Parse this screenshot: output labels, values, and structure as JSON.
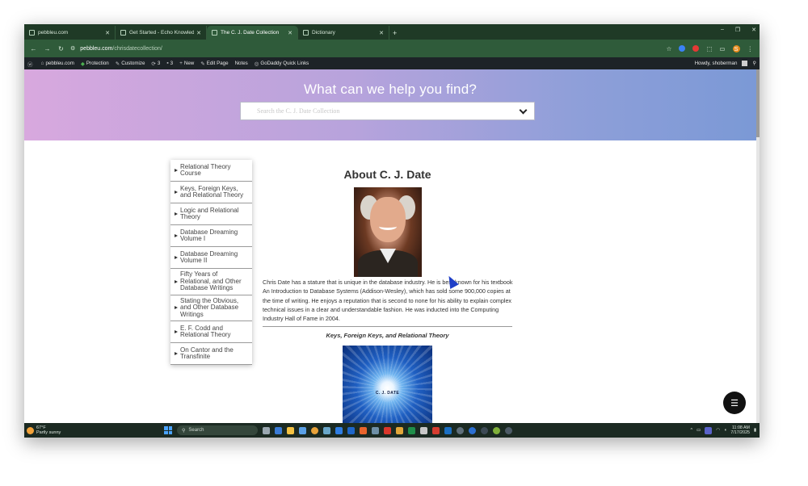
{
  "browser": {
    "tabs": [
      {
        "title": "pebbleu.com",
        "active": false
      },
      {
        "title": "Get Started - Echo Knowledge",
        "active": false
      },
      {
        "title": "The C. J. Date Collection",
        "active": true
      },
      {
        "title": "Dictionary",
        "active": false
      }
    ],
    "url_host": "pebbleu.com",
    "url_path": "/chrisdatecollection/",
    "profile_initial": "S"
  },
  "adminbar": {
    "items": [
      {
        "icon": "wordpress-icon",
        "label": ""
      },
      {
        "icon": "home-icon",
        "label": "pebbleu.com"
      },
      {
        "icon": "shield-icon",
        "label": "Protection"
      },
      {
        "icon": "brush-icon",
        "label": "Customize"
      },
      {
        "icon": "sync-icon",
        "label": "3"
      },
      {
        "icon": "comment-icon",
        "label": "3"
      },
      {
        "icon": "plus-icon",
        "label": "New"
      },
      {
        "icon": "pencil-icon",
        "label": "Edit Page"
      },
      {
        "icon": "",
        "label": "Notes"
      },
      {
        "icon": "godaddy-icon",
        "label": "GoDaddy Quick Links"
      }
    ],
    "howdy": "Howdy, shoberman"
  },
  "hero": {
    "title": "What can we help you find?",
    "search_placeholder": "Search the C. J. Date Collection"
  },
  "sidebar": {
    "items": [
      {
        "label": "Relational Theory Course"
      },
      {
        "label": "Keys, Foreign Keys, and Relational Theory"
      },
      {
        "label": "Logic and Relational Theory"
      },
      {
        "label": "Database Dreaming Volume I"
      },
      {
        "label": "Database Dreaming Volume II"
      },
      {
        "label": "Fifty Years of Relational, and Other Database Writings"
      },
      {
        "label": "Stating the Obvious, and Other Database Writings"
      },
      {
        "label": "E. F. Codd and Relational Theory"
      },
      {
        "label": "On Cantor and the Transfinite"
      }
    ]
  },
  "main": {
    "title": "About C. J. Date",
    "bio": "Chris Date has a stature that is unique in the database industry. He is best known for his textbook An Introduction to Database Systems (Addison-Wesley), which has sold some 900,000 copies at the time of writing. He enjoys a reputation that is second to none for his ability to explain complex technical issues in a clear and understandable fashion. He was inducted into the Computing Industry Hall of Fame in 2004.",
    "book_heading": "Keys, Foreign Keys, and Relational Theory",
    "book_cover_author": "C. J. DATE"
  },
  "taskbar": {
    "temperature": "67°F",
    "weather": "Partly sunny",
    "search_label": "Search",
    "time": "11:08 AM",
    "date": "7/17/2025"
  },
  "colors": {
    "browser_frame": "#1f3a26",
    "hero_start": "#d8a8de",
    "hero_end": "#7b99d6",
    "admin_bar": "#1d2327"
  }
}
